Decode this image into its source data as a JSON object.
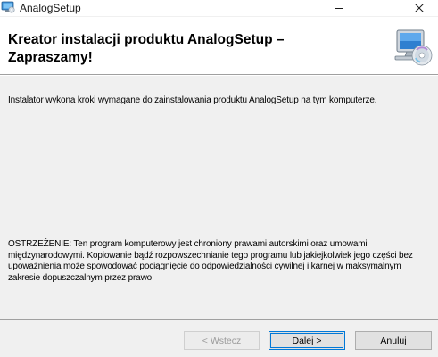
{
  "window": {
    "title": "AnalogSetup",
    "controls": {
      "minimize_icon": "minimize-icon",
      "maximize_icon": "maximize-icon",
      "close_icon": "close-icon"
    }
  },
  "header": {
    "title": "Kreator instalacji produktu AnalogSetup – Zapraszamy!",
    "icon": "computer-cd-icon"
  },
  "body": {
    "intro": "Instalator wykona kroki wymagane do zainstalowania produktu AnalogSetup na tym komputerze.",
    "warning": "OSTRZEŻENIE: Ten program komputerowy jest chroniony prawami autorskimi oraz umowami międzynarodowymi. Kopiowanie bądź rozpowszechnianie tego programu lub jakiejkolwiek jego części bez upoważnienia może spowodować pociągnięcie do odpowiedzialności cywilnej i karnej w maksymalnym zakresie dopuszczalnym przez prawo."
  },
  "buttons": {
    "back": "< Wstecz",
    "next": "Dalej >",
    "cancel": "Anuluj"
  },
  "colors": {
    "focus_border": "#0078d7",
    "dialog_bg": "#f0f0f0",
    "header_bg": "#ffffff"
  }
}
